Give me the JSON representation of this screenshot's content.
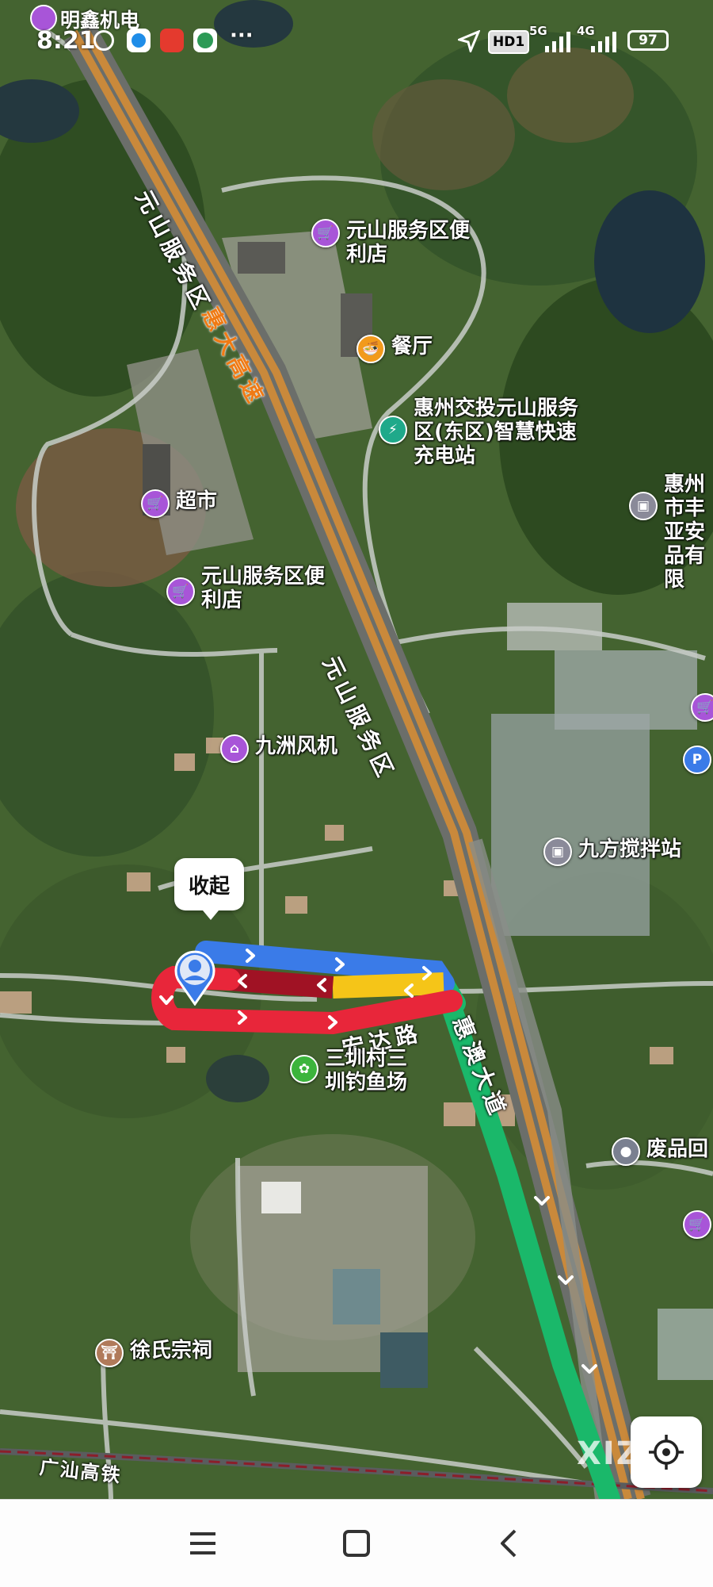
{
  "status_bar": {
    "app_name": "明鑫机电",
    "time": "8:21",
    "network_hd": "HD1",
    "network_5g": "5G",
    "network_4g": "4G",
    "battery": "97"
  },
  "map": {
    "roads": [
      {
        "name": "元山服务区",
        "id": "road-yuanshan-upper"
      },
      {
        "name": "惠大高速",
        "id": "road-huida"
      },
      {
        "name": "元山服务区",
        "id": "road-yuanshan-lower"
      },
      {
        "name": "宏达路",
        "id": "road-hongda"
      },
      {
        "name": "惠澳大道",
        "id": "road-huiao"
      },
      {
        "name": "广汕高铁",
        "id": "road-guangshan"
      }
    ],
    "pois": [
      {
        "name": "元山服务区便利店",
        "icon": "shopping-cart-icon",
        "color": "#a855d8",
        "id": "poi-store-1"
      },
      {
        "name": "餐厅",
        "icon": "restaurant-icon",
        "color": "#f29a1c",
        "id": "poi-restaurant"
      },
      {
        "name": "惠州交投元山服务区(东区)智慧快速充电站",
        "icon": "charging-icon",
        "color": "#1fa98a",
        "id": "poi-charging"
      },
      {
        "name": "超市",
        "icon": "shopping-cart-icon",
        "color": "#a855d8",
        "id": "poi-supermarket"
      },
      {
        "name": "元山服务区便利店",
        "icon": "shopping-cart-icon",
        "color": "#a855d8",
        "id": "poi-store-2"
      },
      {
        "name": "惠州市丰亚安品有限",
        "icon": "company-icon",
        "color": "#8a8a99",
        "id": "poi-company"
      },
      {
        "name": "九洲风机",
        "icon": "shop-icon",
        "color": "#a855d8",
        "id": "poi-jiuzhou"
      },
      {
        "name": "九方搅拌站",
        "icon": "company-icon",
        "color": "#8a8a99",
        "id": "poi-jiufang"
      },
      {
        "name": "三圳村三圳钓鱼场",
        "icon": "fishing-icon",
        "color": "#3cb43c",
        "id": "poi-fishing"
      },
      {
        "name": "废品回",
        "icon": "recycle-icon",
        "color": "#7a8090",
        "id": "poi-recycle"
      },
      {
        "name": "徐氏宗祠",
        "icon": "temple-icon",
        "color": "#b07a5a",
        "id": "poi-temple"
      }
    ],
    "parking_label": "P",
    "collapse_label": "收起",
    "watermark": "XIZ",
    "route_colors": {
      "smooth": "#1ab86a",
      "slow": "#f5c518",
      "congested": "#e8263a",
      "severe": "#a01224",
      "blue": "#3a7be8"
    }
  },
  "nav_bar": {
    "menu_icon": "menu-icon",
    "home_icon": "home-icon",
    "back_icon": "back-icon"
  }
}
